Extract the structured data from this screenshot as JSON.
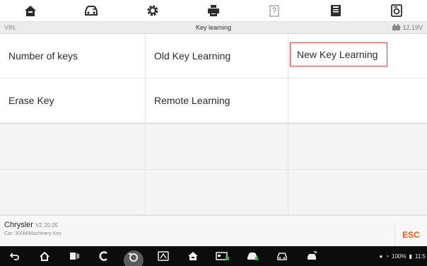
{
  "toolbar": {
    "icons": [
      "home-icon",
      "vehicle-swap-icon",
      "settings-icon",
      "print-icon",
      "help-icon",
      "save-icon",
      "datalogging-icon"
    ]
  },
  "header": {
    "vin_label": "VIN:",
    "title": "Key learning",
    "voltage": "12.19V"
  },
  "menu": {
    "items": [
      "Number of keys",
      "Old Key Learning",
      "New Key Learning",
      "Erase Key",
      "Remote Learning"
    ],
    "selected": "New Key Learning"
  },
  "footer": {
    "brand": "Chrysler",
    "version": "V2.20.05",
    "car": "Car: 300M/Machinery Key",
    "esc_label": "ESC"
  },
  "navbar": {
    "icons": [
      "back-icon",
      "home-icon",
      "recent-apps-icon",
      "browser-icon",
      "camera-icon",
      "scan-icon",
      "maxisys-home-icon",
      "vci-icon",
      "car-icon",
      "car-icon",
      "car-repair-icon"
    ],
    "battery": "100%",
    "time": "11:5"
  },
  "colors": {
    "accent_red": "#e0393e",
    "esc_orange": "#e45a1c"
  }
}
